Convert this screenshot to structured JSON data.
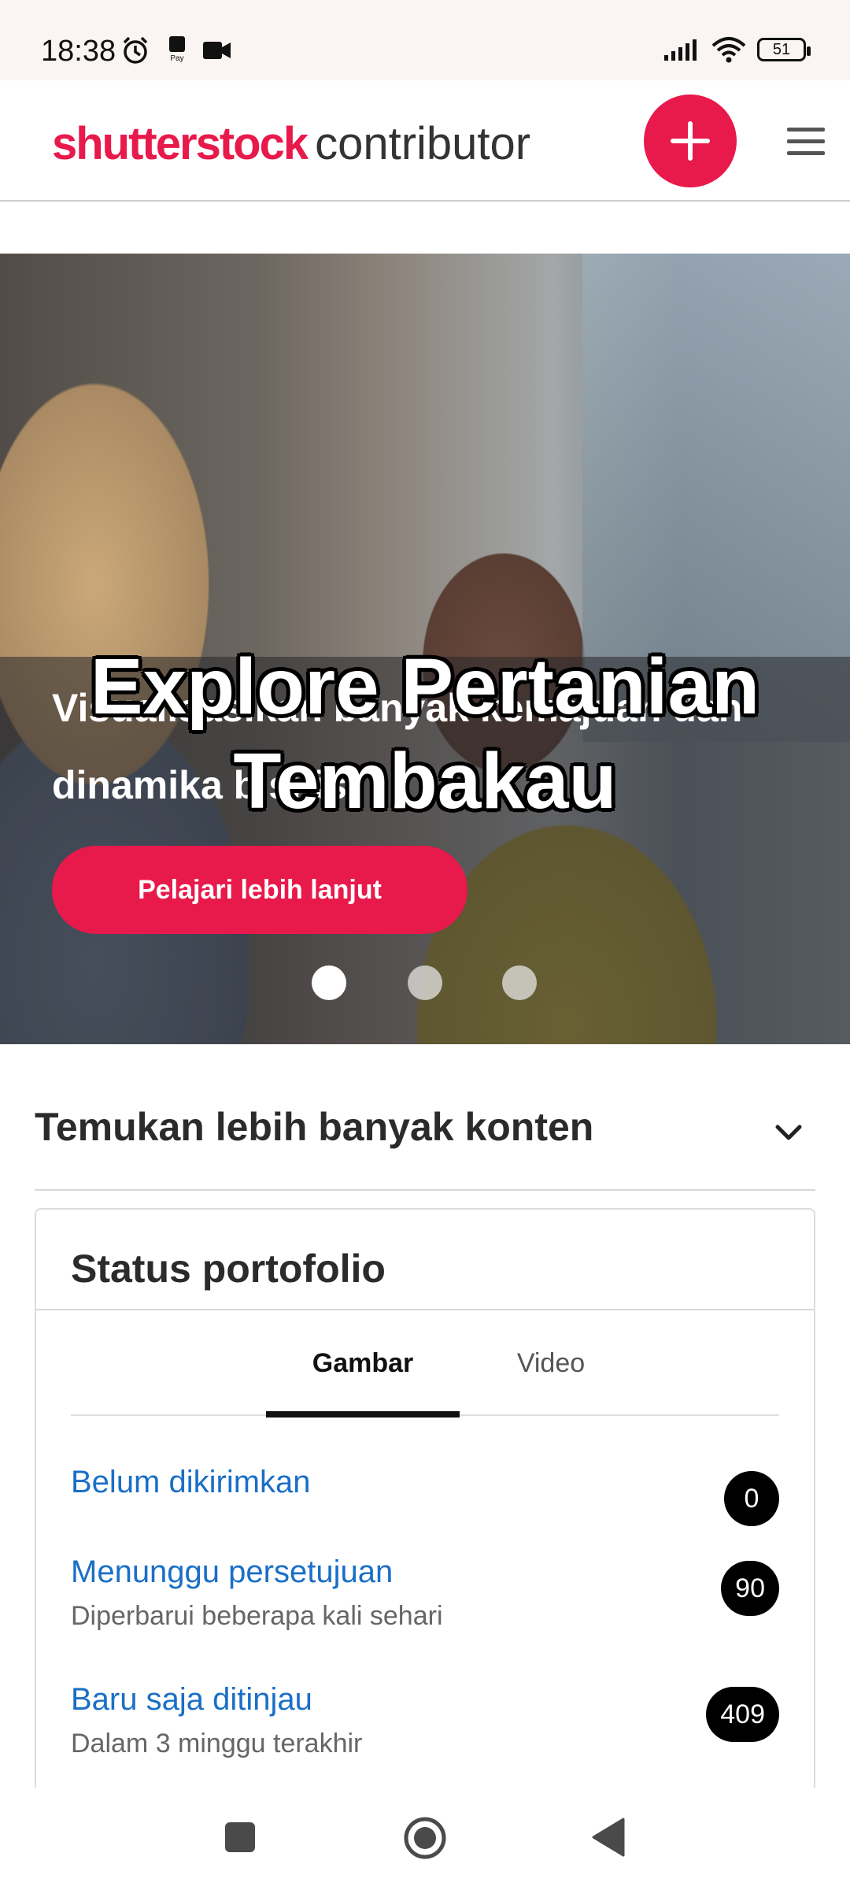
{
  "status_bar": {
    "time": "18:38",
    "battery": "51",
    "icons": [
      "alarm-icon",
      "pay-icon",
      "video-camera-icon",
      "signal-icon",
      "wifi-icon",
      "battery-icon"
    ]
  },
  "header": {
    "brand": "shutterstock",
    "product": "contributor",
    "add_icon": "plus-icon",
    "menu_icon": "hamburger-menu-icon",
    "accent": "#e8194b"
  },
  "hero": {
    "text": "Visualisasikan banyak kemajuan dan dinamika bisnis",
    "overlay_caption": "Explore Pertanian Tembakau",
    "cta_label": "Pelajari lebih lanjut",
    "slide_count": 3,
    "active_slide": 1
  },
  "discover": {
    "title": "Temukan lebih banyak konten",
    "chevron_icon": "chevron-down-icon"
  },
  "portfolio": {
    "title": "Status portofolio",
    "tabs": [
      {
        "label": "Gambar",
        "active": true
      },
      {
        "label": "Video",
        "active": false
      }
    ],
    "rows": [
      {
        "label": "Belum dikirimkan",
        "sub": "",
        "count": "0"
      },
      {
        "label": "Menunggu persetujuan",
        "sub": "Diperbarui beberapa kali sehari",
        "count": "90"
      },
      {
        "label": "Baru saja ditinjau",
        "sub": "Dalam 3 minggu terakhir",
        "count": "409"
      }
    ]
  },
  "nav_bar": {
    "icons": [
      "recents-square-icon",
      "home-circle-icon",
      "back-triangle-icon"
    ]
  }
}
